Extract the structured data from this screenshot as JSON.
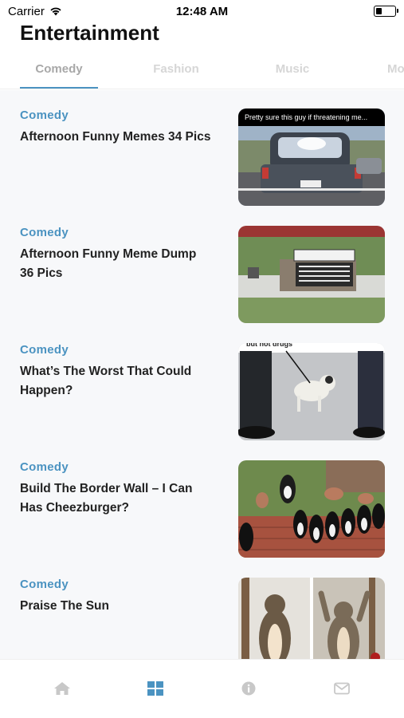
{
  "status_bar": {
    "carrier": "Carrier",
    "time": "12:48 AM",
    "battery_level": 0.3
  },
  "header": {
    "title": "Entertainment"
  },
  "tabs": [
    {
      "label": "Comedy",
      "active": true
    },
    {
      "label": "Fashion",
      "active": false
    },
    {
      "label": "Music",
      "active": false
    },
    {
      "label": "Mo",
      "active": false
    }
  ],
  "feed": {
    "items": [
      {
        "category": "Comedy",
        "title": "Afternoon Funny Memes 34 Pics",
        "thumb_caption": "Pretty sure this guy if threatening me...",
        "thumb_icon": "car-photo"
      },
      {
        "category": "Comedy",
        "title": "Afternoon Funny Meme Dump 36 Pics",
        "thumb_icon": "sign-photo"
      },
      {
        "category": "Comedy",
        "title": "What’s The Worst That Could Happen?",
        "thumb_caption": "but not drugs",
        "thumb_icon": "dog-photo"
      },
      {
        "category": "Comedy",
        "title": "Build The Border Wall – I Can Has Cheezburger?",
        "thumb_icon": "cats-wall-photo"
      },
      {
        "category": "Comedy",
        "title": "Praise The Sun",
        "thumb_icon": "cats-sun-photo"
      }
    ]
  },
  "tab_bar": {
    "items": [
      {
        "icon": "home-icon",
        "active": false
      },
      {
        "icon": "grid-icon",
        "active": true
      },
      {
        "icon": "info-icon",
        "active": false
      },
      {
        "icon": "mail-icon",
        "active": false
      }
    ]
  },
  "colors": {
    "accent": "#4b93c1",
    "inactive_tab": "#d6d6d6",
    "tabbar_inactive": "#c8c8c8"
  }
}
